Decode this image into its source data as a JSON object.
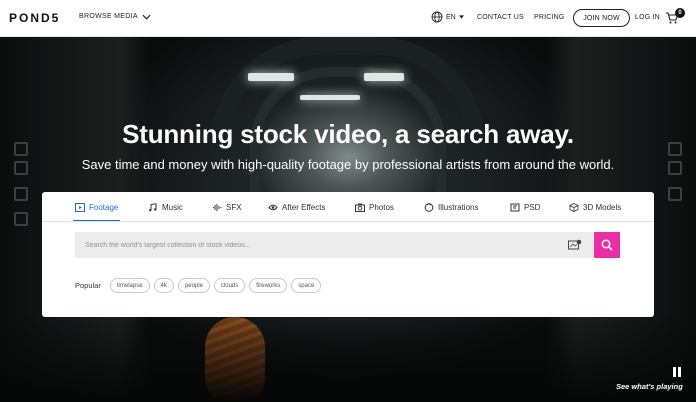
{
  "header": {
    "logo": "POND5",
    "browse_label": "BROWSE MEDIA",
    "language": "EN",
    "contact": "CONTACT US",
    "pricing": "PRICING",
    "join": "JOIN NOW",
    "login": "LOG IN",
    "cart_count": "0"
  },
  "hero": {
    "headline": "Stunning stock video, a search away.",
    "subline": "Save time and money with high-quality footage by professional artists from around the world."
  },
  "search": {
    "tabs": [
      {
        "label": "Footage",
        "icon": "film-icon",
        "active": true
      },
      {
        "label": "Music",
        "icon": "music-note-icon",
        "active": false
      },
      {
        "label": "SFX",
        "icon": "sound-wave-icon",
        "active": false
      },
      {
        "label": "After Effects",
        "icon": "after-effects-icon",
        "active": false
      },
      {
        "label": "Photos",
        "icon": "camera-icon",
        "active": false
      },
      {
        "label": "Illustrations",
        "icon": "illustration-icon",
        "active": false
      },
      {
        "label": "PSD",
        "icon": "psd-icon",
        "active": false
      },
      {
        "label": "3D Models",
        "icon": "cube-icon",
        "active": false
      }
    ],
    "placeholder": "Search the world's largest collection of stock videos...",
    "popular_label": "Popular",
    "popular_terms": [
      "timelapse",
      "4k",
      "people",
      "clouds",
      "fireworks",
      "space"
    ]
  },
  "player": {
    "see_whats_playing": "See what's playing"
  },
  "colors": {
    "accent": "#1f6fd1",
    "search_button": "#e92ea6"
  }
}
